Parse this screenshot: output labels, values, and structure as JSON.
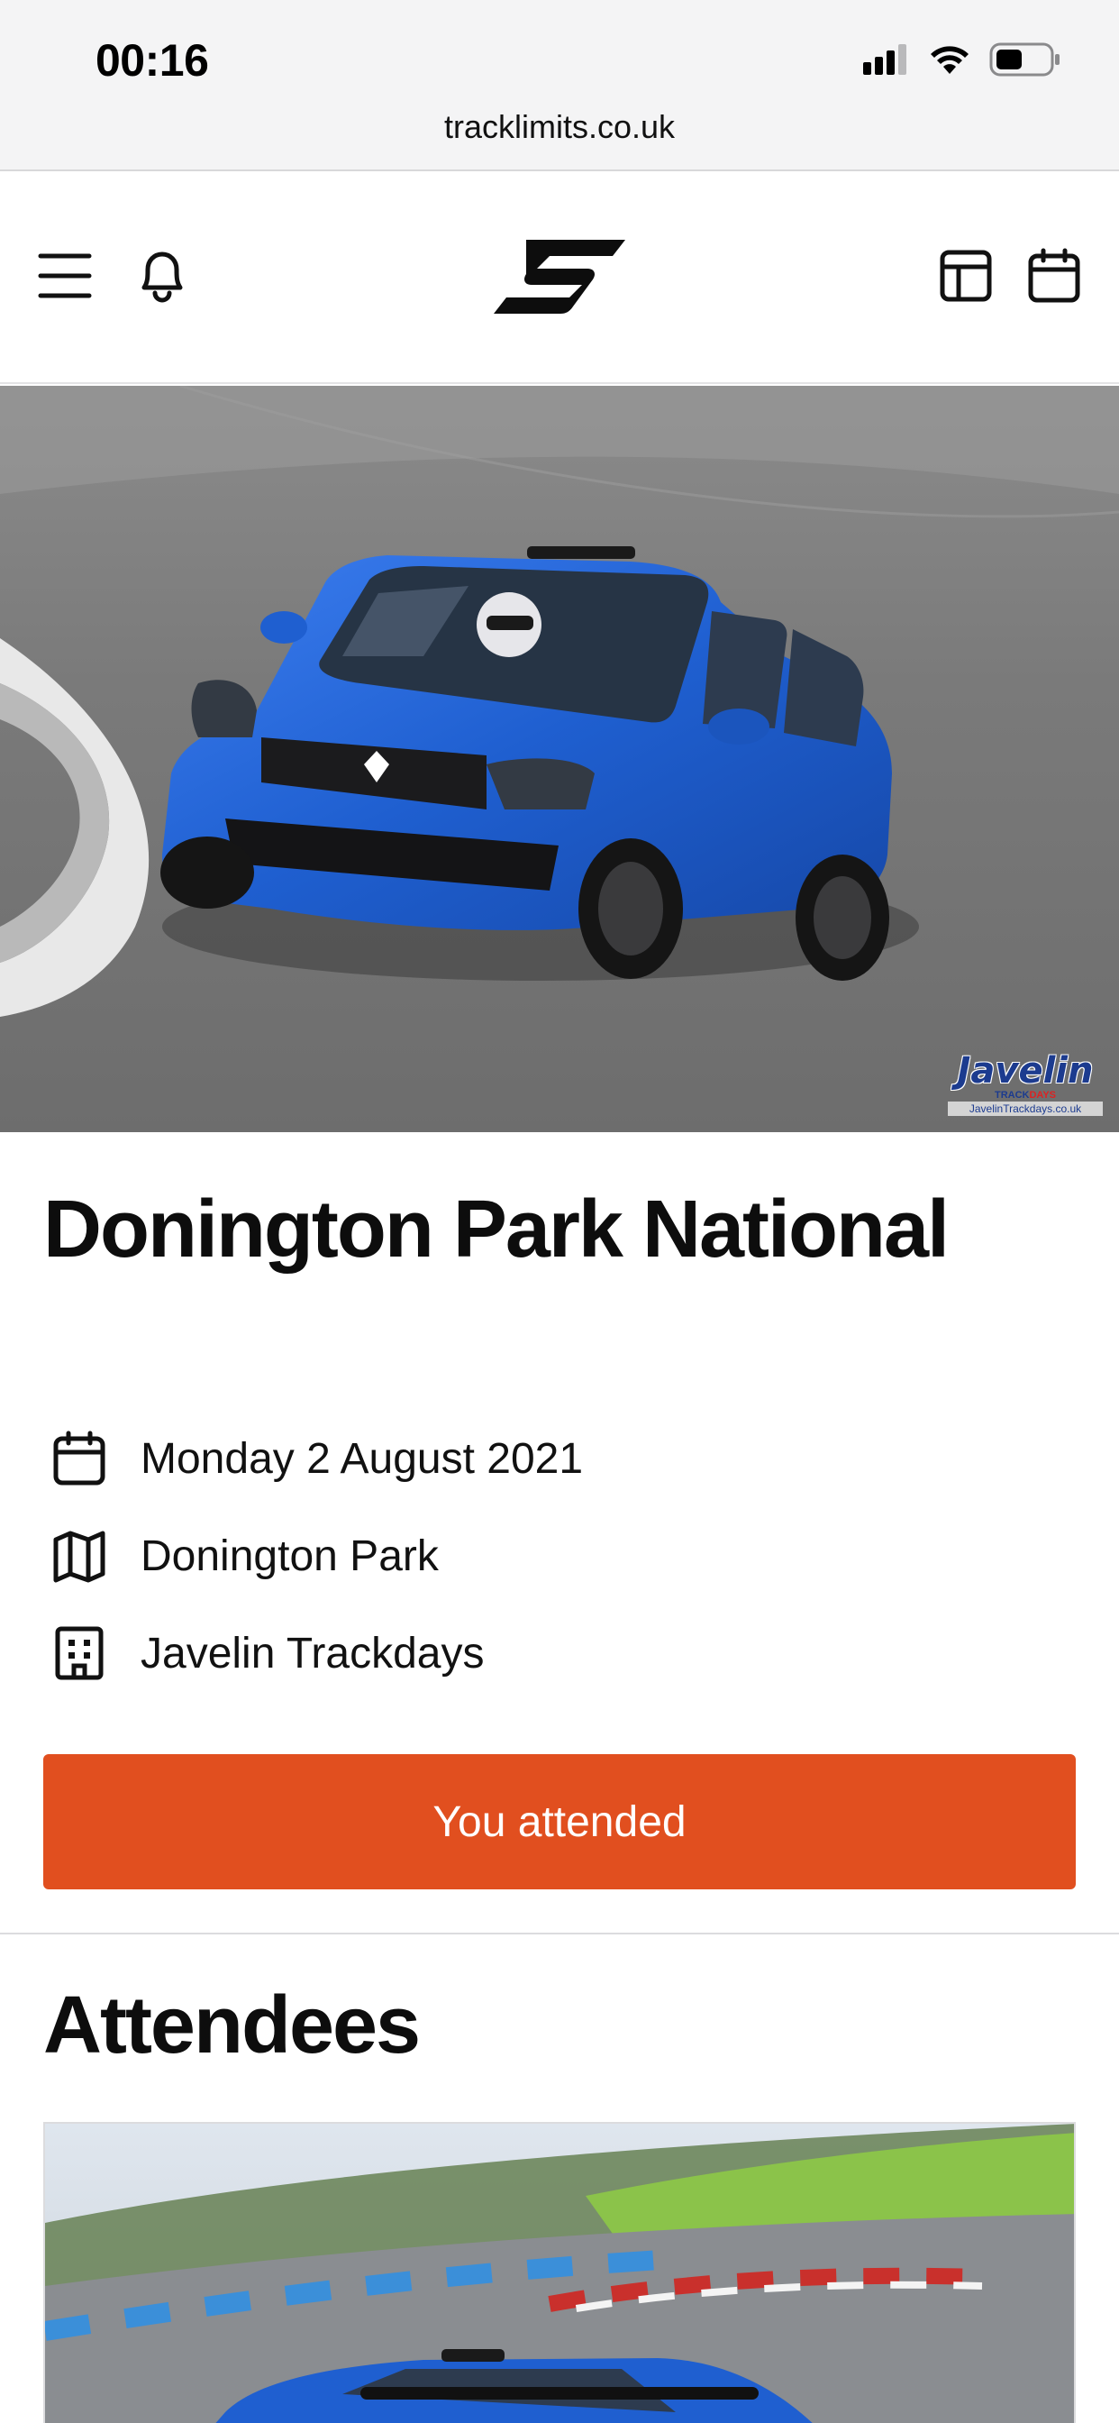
{
  "status_bar": {
    "time": "00:16",
    "icons": [
      "signal-icon",
      "wifi-icon",
      "battery-icon"
    ]
  },
  "browser": {
    "url": "tracklimits.co.uk"
  },
  "header": {
    "icons": [
      "menu-icon",
      "bell-icon",
      "tracklimits-logo",
      "layout-icon",
      "calendar-icon"
    ]
  },
  "event": {
    "title": "Donington Park National",
    "date": "Monday 2 August 2021",
    "circuit": "Donington Park",
    "organiser": "Javelin Trackdays",
    "attend_label": "You attended",
    "hero_watermark": {
      "brand": "Javelin",
      "sub": "TRACKDAYS",
      "site": "JavelinTrackdays.co.uk"
    }
  },
  "attendees": {
    "title": "Attendees"
  },
  "colors": {
    "accent": "#e14f1f",
    "car_blue": "#1f5fd0",
    "text": "#0d0d0d"
  }
}
